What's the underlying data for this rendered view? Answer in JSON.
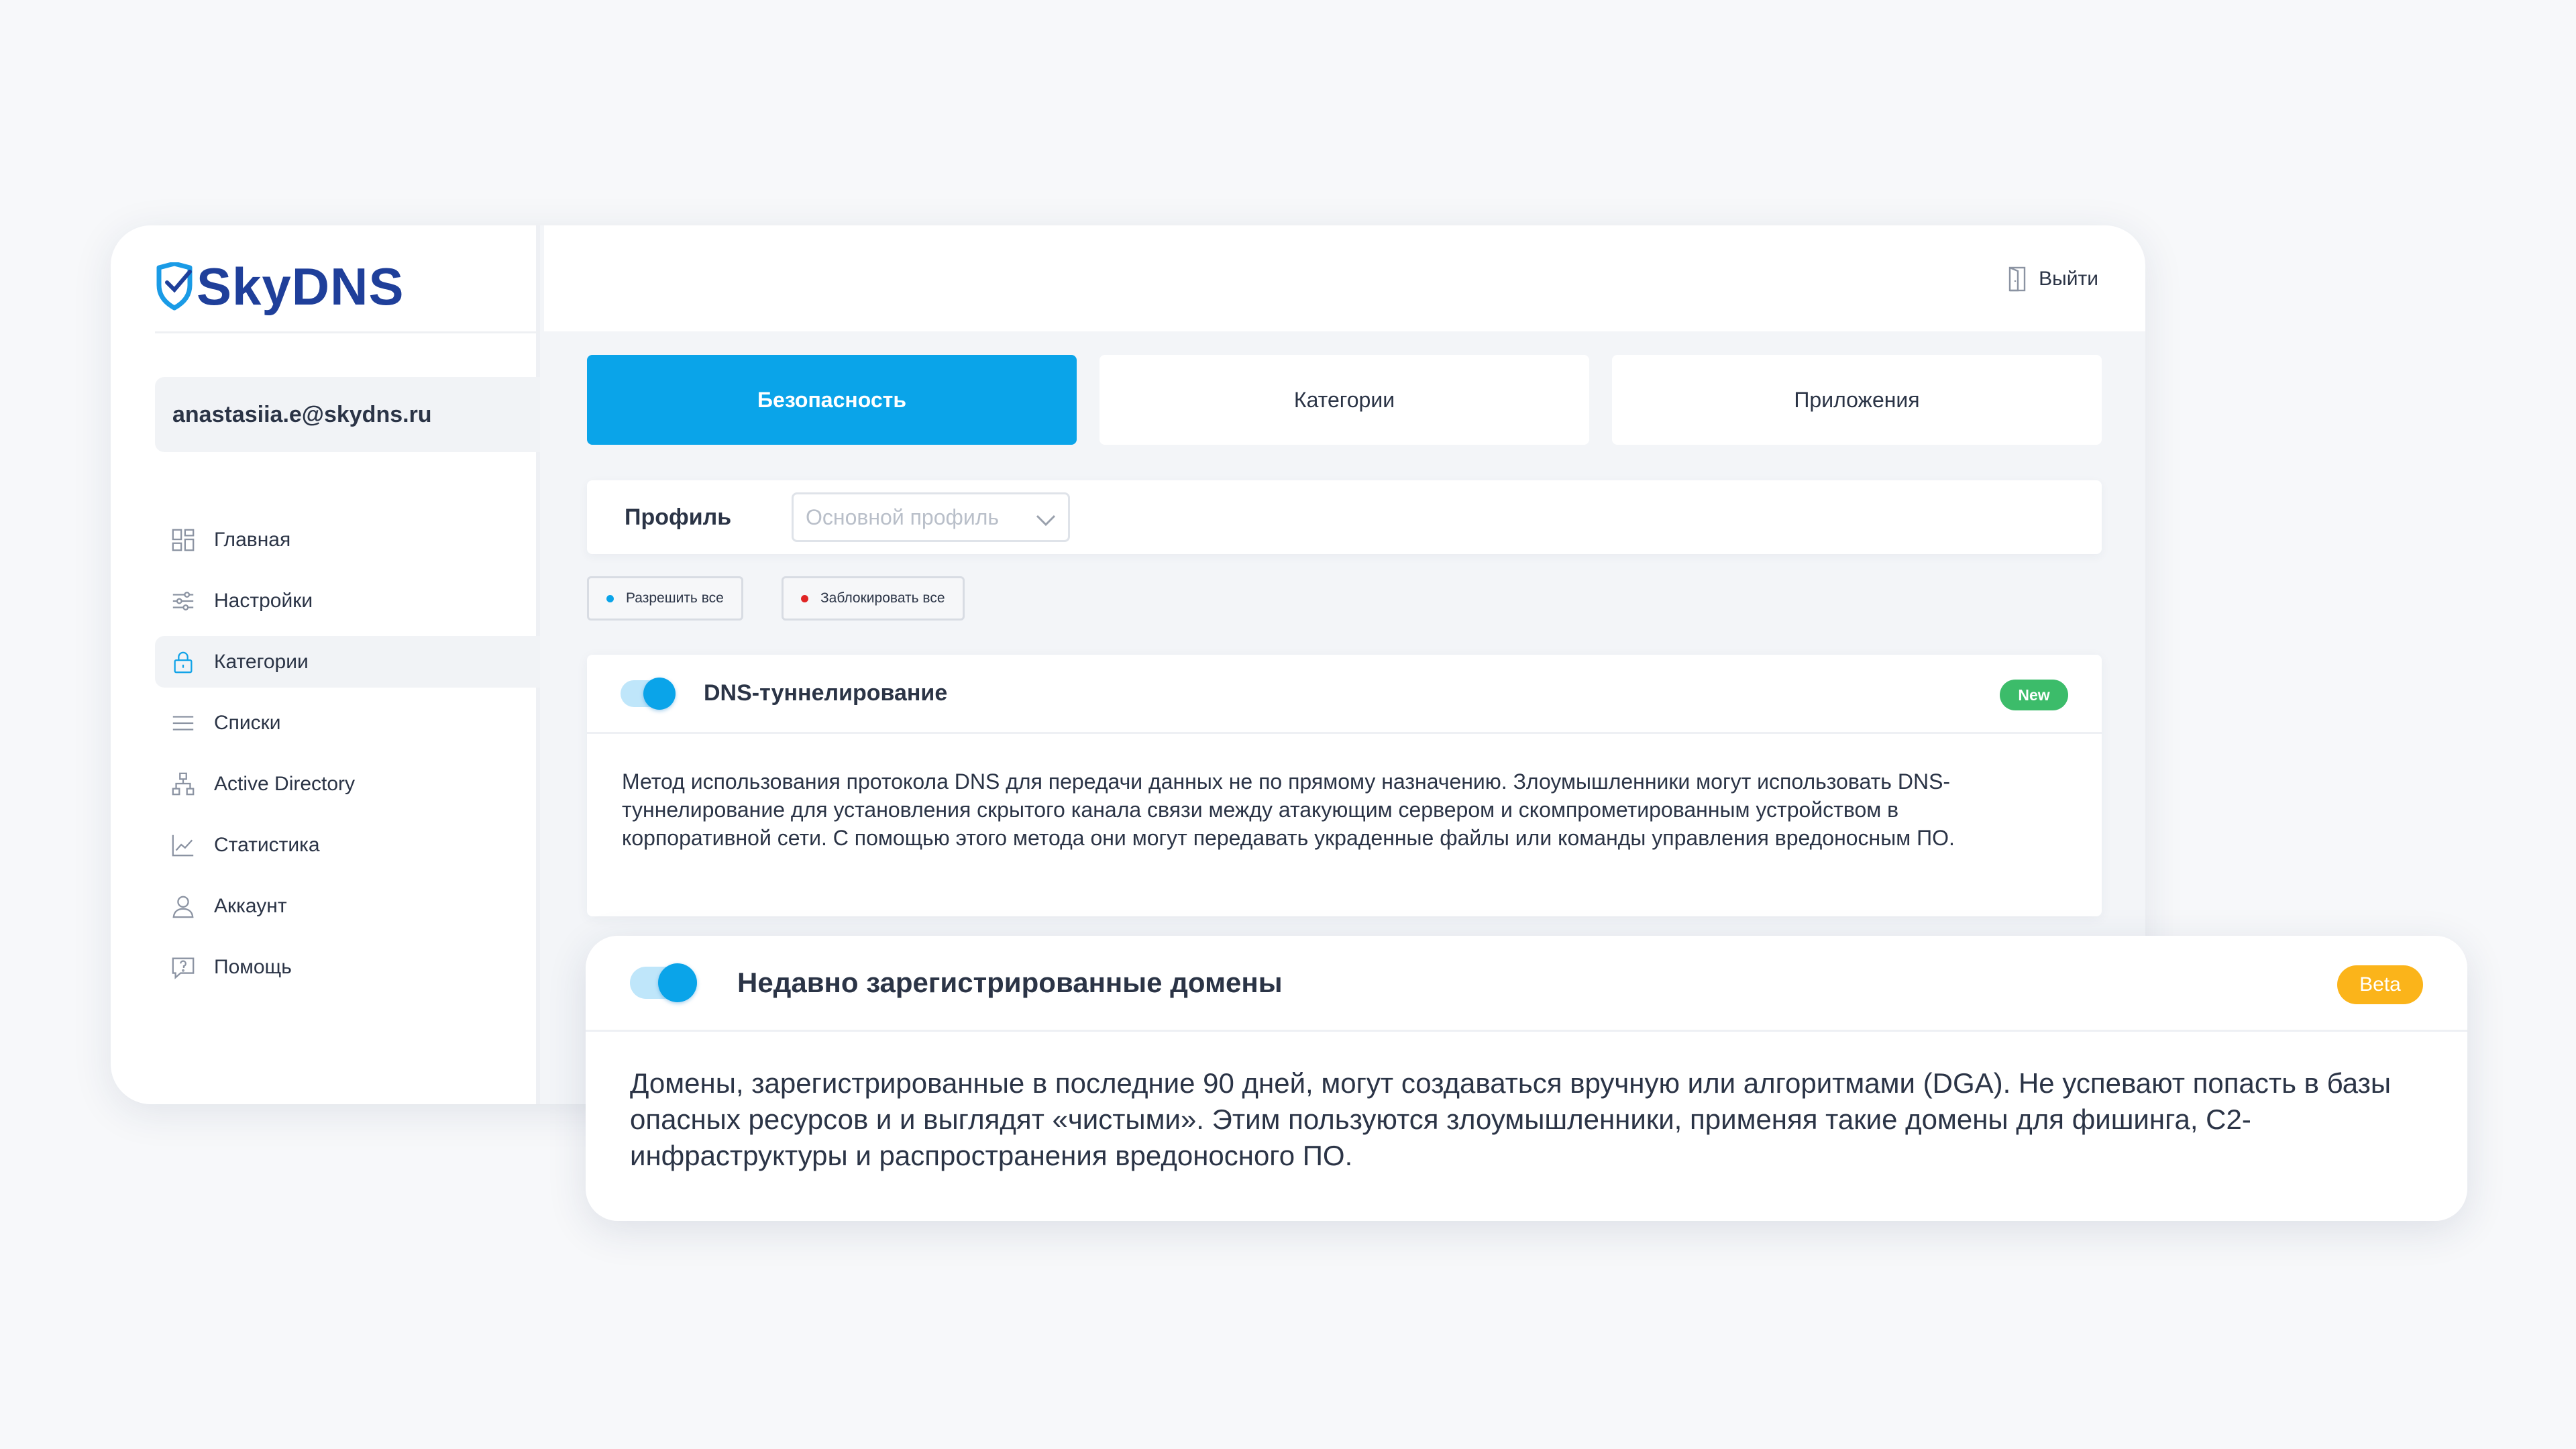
{
  "brand": {
    "logo_text": "SkyDNS"
  },
  "user": {
    "email": "anastasiia.e@skydns.ru"
  },
  "sidebar": {
    "items": [
      {
        "label": "Главная",
        "icon": "dashboard-icon"
      },
      {
        "label": "Настройки",
        "icon": "sliders-icon"
      },
      {
        "label": "Категории",
        "icon": "lock-icon",
        "active": true
      },
      {
        "label": "Списки",
        "icon": "list-icon"
      },
      {
        "label": "Active Directory",
        "icon": "network-icon"
      },
      {
        "label": "Статистика",
        "icon": "chart-icon"
      },
      {
        "label": "Аккаунт",
        "icon": "user-icon"
      },
      {
        "label": "Помощь",
        "icon": "help-icon"
      }
    ]
  },
  "header": {
    "logout_label": "Выйти"
  },
  "tabs": [
    {
      "label": "Безопасность",
      "active": true
    },
    {
      "label": "Категории"
    },
    {
      "label": "Приложения"
    }
  ],
  "profile": {
    "label": "Профиль",
    "select_value": "Основной профиль"
  },
  "actions": {
    "allow_all": "Разрешить все",
    "block_all": "Заблокировать все"
  },
  "categories": [
    {
      "title": "DNS-туннелирование",
      "badge": "New",
      "enabled": true,
      "description": "Метод использования протокола DNS для передачи данных не по прямому назначению. Злоумышленники могут использовать DNS-туннелирование для установления скрытого канала связи между атакующим сервером и скомпрометированным устройством в корпоративной сети. С помощью этого метода они могут передавать украденные файлы или команды управления вредоносным ПО."
    },
    {
      "title": "Недавно зарегистрированные домены",
      "badge": "Beta",
      "enabled": true,
      "description": "Домены, зарегистрированные в последние 90 дней, могут создаваться вручную или алгоритмами (DGA). Не успевают попасть в базы опасных ресурсов и и выглядят «чистыми». Этим пользуются злоумышленники, применяя такие домены для фишинга, C2-инфраструктуры и распространения вредоносного ПО."
    }
  ],
  "colors": {
    "accent": "#0aa4e9",
    "brand": "#1f3f9a",
    "badge_new": "#3cbc6a",
    "badge_beta": "#fbb41a",
    "allow_dot": "#0aa4e9",
    "block_dot": "#e02424"
  }
}
